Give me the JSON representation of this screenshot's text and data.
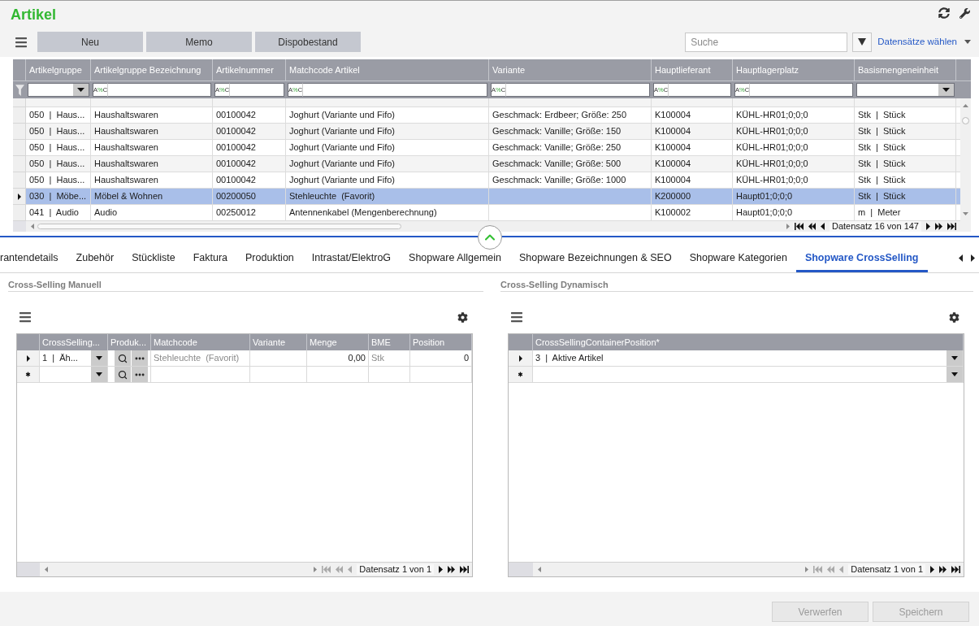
{
  "header": {
    "title": "Artikel"
  },
  "toolbar": {
    "buttons": [
      "Neu",
      "Memo",
      "Dispobestand"
    ],
    "search": {
      "placeholder": "Suche"
    },
    "records_link": "Datensätze wählen"
  },
  "main_table": {
    "columns": [
      {
        "label": "Artikelgruppe",
        "kind": "dropdown"
      },
      {
        "label": "Artikelgruppe Bezeichnung",
        "kind": "text",
        "operator": "A%C"
      },
      {
        "label": "Artikelnummer",
        "kind": "text",
        "operator": "A%C"
      },
      {
        "label": "Matchcode Artikel",
        "kind": "text",
        "operator": "A%C"
      },
      {
        "label": "Variante",
        "kind": "text",
        "operator": "A%C"
      },
      {
        "label": "Hauptlieferant",
        "kind": "text",
        "operator": "A%C"
      },
      {
        "label": "Hauptlagerplatz",
        "kind": "text",
        "operator": "A%C"
      },
      {
        "label": "Basismengeneinheit",
        "kind": "dropdown"
      }
    ],
    "rows": [
      {
        "selected": false,
        "cells": [
          "050  |  Haus...",
          "Haushaltswaren",
          "00100042",
          "Joghurt (Variante und Fifo)",
          "Geschmack: Erdbeer; Größe: 250",
          "K100004",
          "KÜHL-HR01;0;0;0",
          "Stk  |  Stück"
        ]
      },
      {
        "selected": false,
        "cells": [
          "050  |  Haus...",
          "Haushaltswaren",
          "00100042",
          "Joghurt (Variante und Fifo)",
          "Geschmack: Vanille; Größe: 150",
          "K100004",
          "KÜHL-HR01;0;0;0",
          "Stk  |  Stück"
        ]
      },
      {
        "selected": false,
        "cells": [
          "050  |  Haus...",
          "Haushaltswaren",
          "00100042",
          "Joghurt (Variante und Fifo)",
          "Geschmack: Vanille; Größe: 250",
          "K100004",
          "KÜHL-HR01;0;0;0",
          "Stk  |  Stück"
        ]
      },
      {
        "selected": false,
        "cells": [
          "050  |  Haus...",
          "Haushaltswaren",
          "00100042",
          "Joghurt (Variante und Fifo)",
          "Geschmack: Vanille; Größe: 500",
          "K100004",
          "KÜHL-HR01;0;0;0",
          "Stk  |  Stück"
        ]
      },
      {
        "selected": false,
        "cells": [
          "050  |  Haus...",
          "Haushaltswaren",
          "00100042",
          "Joghurt (Variante und Fifo)",
          "Geschmack: Vanille; Größe: 1000",
          "K100004",
          "KÜHL-HR01;0;0;0",
          "Stk  |  Stück"
        ]
      },
      {
        "selected": true,
        "cells": [
          "030  |  Möbe...",
          "Möbel & Wohnen",
          "00200050",
          "Stehleuchte  (Favorit)",
          null,
          "K200000",
          "Haupt01;0;0;0",
          "Stk  |  Stück"
        ]
      },
      {
        "selected": false,
        "cells": [
          "041  |  Audio",
          "Audio",
          "00250012",
          "Antennenkabel (Mengenberechnung)",
          null,
          "K100002",
          "Haupt01;0;0;0",
          "m  |  Meter"
        ]
      }
    ],
    "navigator": {
      "status": "Datensatz 16 von 147",
      "back_disabled": false
    }
  },
  "detail_tabs": [
    {
      "label": "rantendetails",
      "selected": false
    },
    {
      "label": "Zubehör",
      "selected": false
    },
    {
      "label": "Stückliste",
      "selected": false
    },
    {
      "label": "Faktura",
      "selected": false
    },
    {
      "label": "Produktion",
      "selected": false
    },
    {
      "label": "Intrastat/ElektroG",
      "selected": false
    },
    {
      "label": "Shopware Allgemein",
      "selected": false
    },
    {
      "label": "Shopware Bezeichnungen & SEO",
      "selected": false
    },
    {
      "label": "Shopware Kategorien",
      "selected": false
    },
    {
      "label": "Shopware CrossSelling",
      "selected": true
    }
  ],
  "cross_selling_manual": {
    "title": "Cross-Selling Manuell",
    "columns": [
      {
        "label": "CrossSelling...",
        "kind": "combo"
      },
      {
        "label": "Produk...",
        "kind": "lookup"
      },
      {
        "label": "Matchcode",
        "kind": "readonly"
      },
      {
        "label": "Variante",
        "kind": "readonly"
      },
      {
        "label": "Menge",
        "kind": "number"
      },
      {
        "label": "BME",
        "kind": "readonly"
      },
      {
        "label": "Position",
        "kind": "number"
      }
    ],
    "rows": [
      {
        "kind": "current",
        "cells": [
          "1  |  Äh...",
          null,
          "Stehleuchte  (Favorit)",
          null,
          "0,00",
          "Stk",
          "0"
        ]
      },
      {
        "kind": "new"
      }
    ],
    "navigator": {
      "status": "Datensatz 1 von 1",
      "back_disabled": true
    }
  },
  "cross_selling_dynamic": {
    "title": "Cross-Selling Dynamisch",
    "columns": [
      {
        "label": "CrossSellingContainerPosition*",
        "kind": "combo"
      }
    ],
    "rows": [
      {
        "kind": "current",
        "cells": [
          "3  |  Aktive Artikel"
        ]
      },
      {
        "kind": "new"
      }
    ],
    "navigator": {
      "status": "Datensatz 1 von 1",
      "back_disabled": true
    }
  },
  "footer": {
    "buttons": [
      {
        "label": "Verwerfen",
        "disabled": true
      },
      {
        "label": "Speichern",
        "disabled": true
      }
    ]
  }
}
